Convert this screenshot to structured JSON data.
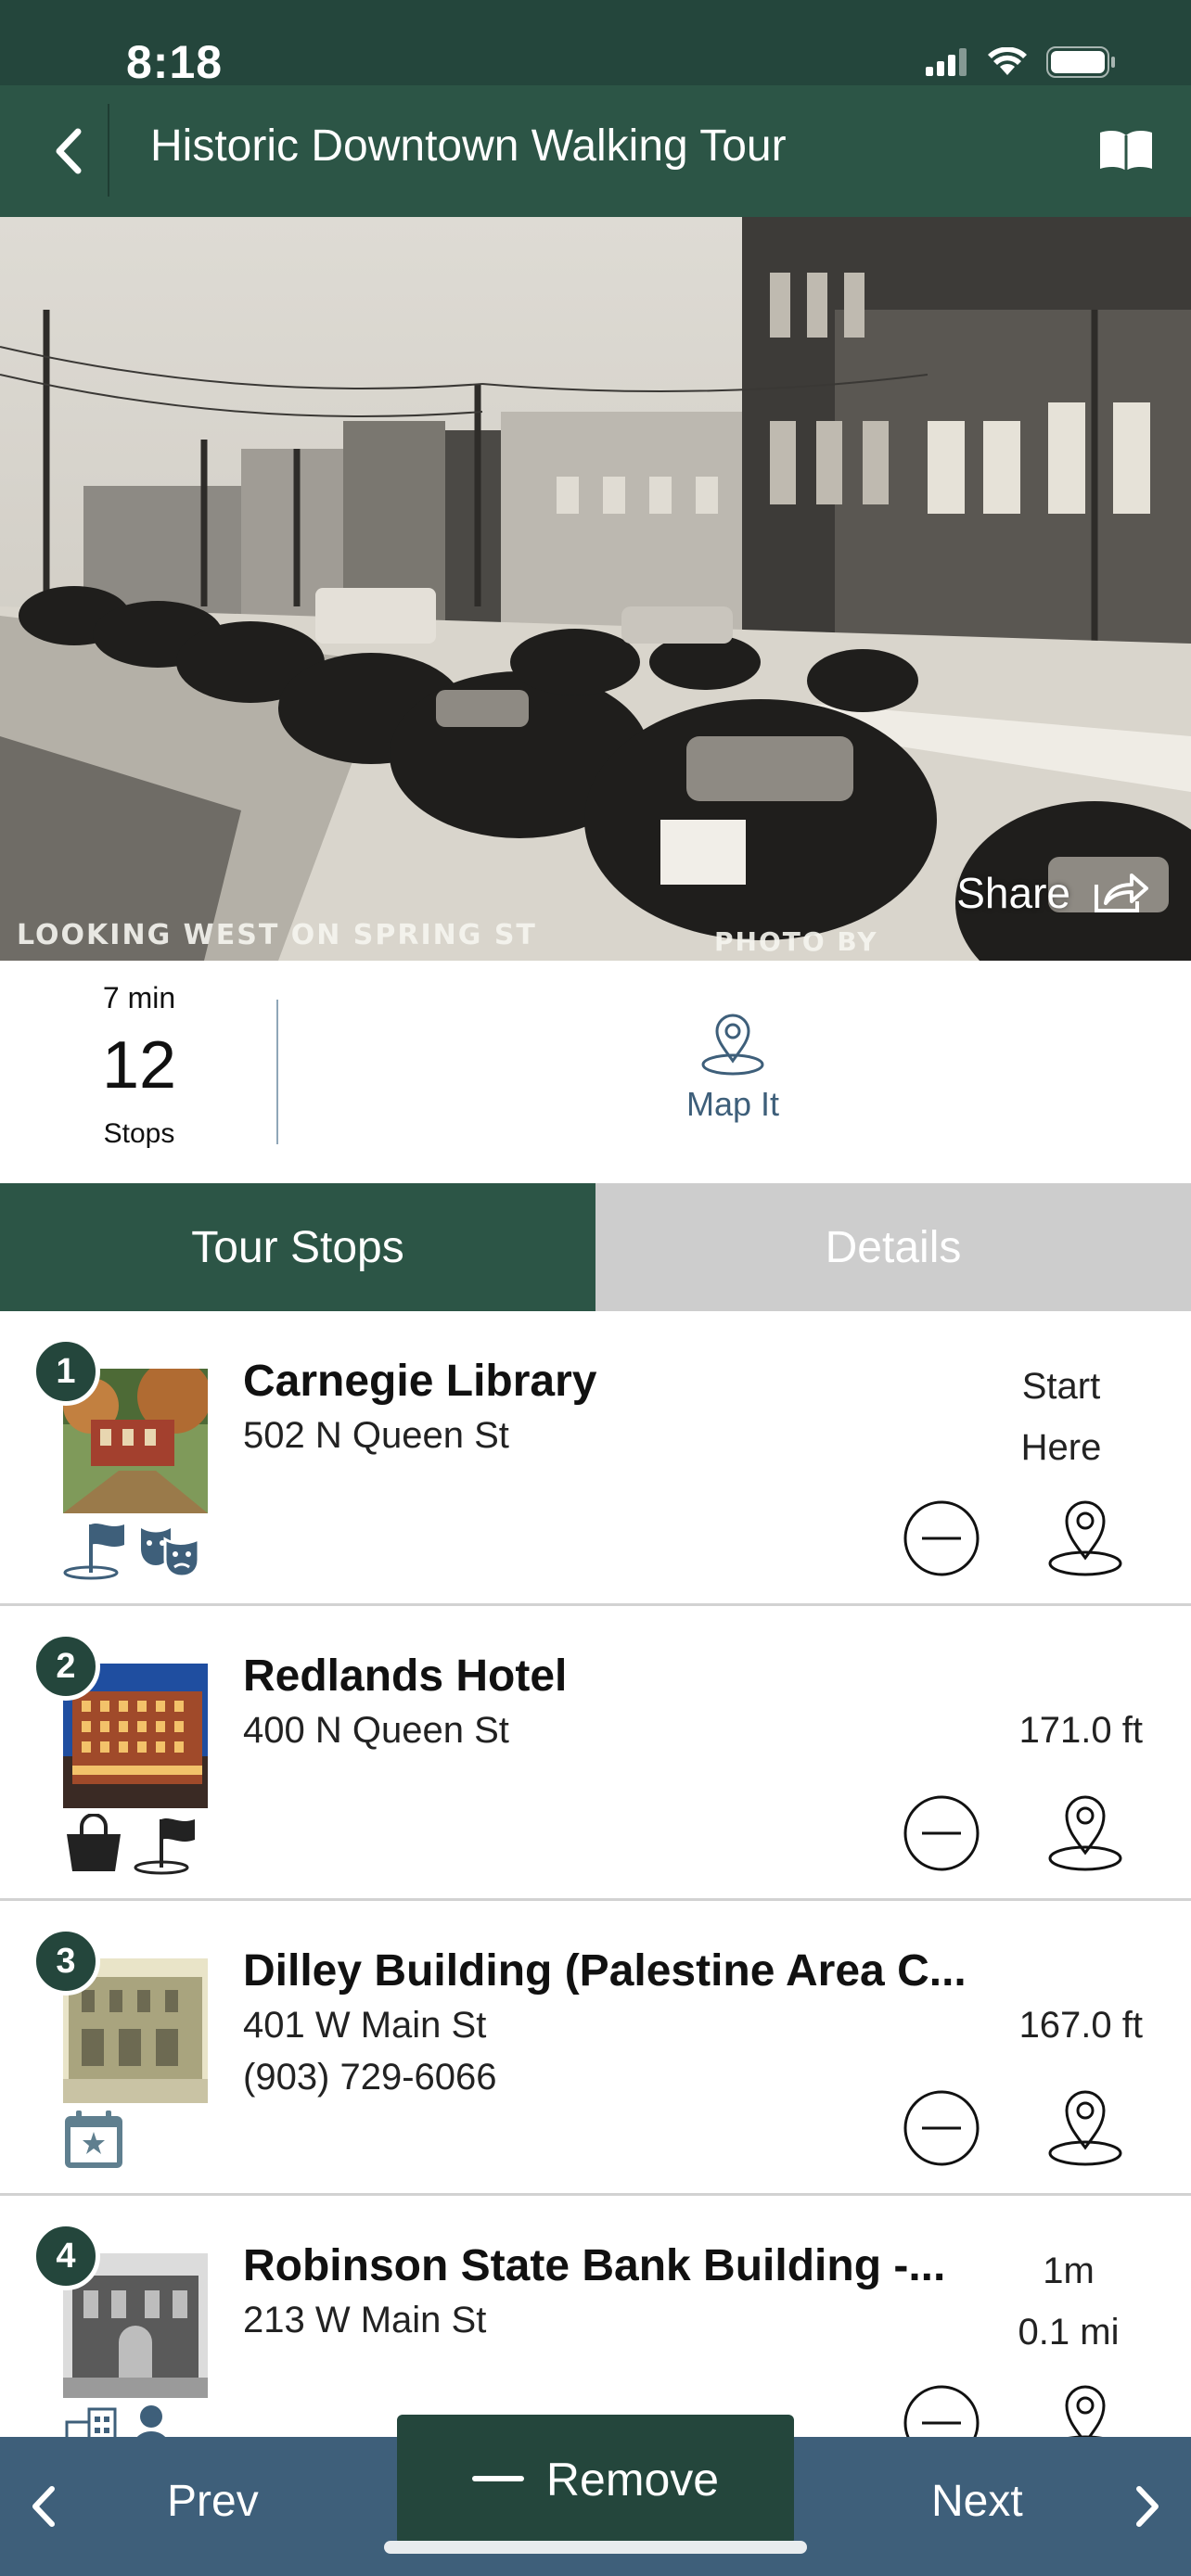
{
  "status_bar": {
    "time": "8:18"
  },
  "header": {
    "title": "Historic Downtown Walking Tour"
  },
  "hero": {
    "caption_left": "LOOKING WEST ON SPRING ST",
    "caption_right": "PHOTO BY",
    "share_label": "Share"
  },
  "summary": {
    "duration": "7 min",
    "stop_count": "12",
    "stops_label": "Stops",
    "map_it_label": "Map It"
  },
  "tabs": [
    {
      "label": "Tour Stops",
      "active": true
    },
    {
      "label": "Details",
      "active": false
    }
  ],
  "stops": [
    {
      "number": "1",
      "name": "Carnegie Library",
      "address": "502 N Queen St",
      "phone": "",
      "distance_line1": "Start",
      "distance_line2": "Here",
      "categories": [
        "flag-icon",
        "theater-masks-icon"
      ]
    },
    {
      "number": "2",
      "name": "Redlands Hotel",
      "address": "400 N Queen St",
      "phone": "",
      "distance_line1": "",
      "distance_line2": "171.0 ft",
      "categories": [
        "shopping-bag-icon",
        "flag-icon"
      ]
    },
    {
      "number": "3",
      "name": "Dilley Building (Palestine Area C...",
      "address": "401 W Main St",
      "phone": "(903) 729-6066",
      "distance_line1": "",
      "distance_line2": "167.0 ft",
      "categories": [
        "calendar-star-icon"
      ]
    },
    {
      "number": "4",
      "name": "Robinson State Bank Building -...",
      "address": "213 W Main St",
      "phone": "",
      "distance_line1": "1m",
      "distance_line2": "0.1 mi",
      "categories": [
        "city-buildings-icon",
        "person-icon"
      ]
    }
  ],
  "bottom_nav": {
    "prev_label": "Prev",
    "remove_label": "Remove",
    "next_label": "Next"
  },
  "colors": {
    "header_bg": "#2c5546",
    "status_bg": "#24463c",
    "accent_blue": "#3e5f7a",
    "tab_inactive": "#cdcdcd"
  }
}
